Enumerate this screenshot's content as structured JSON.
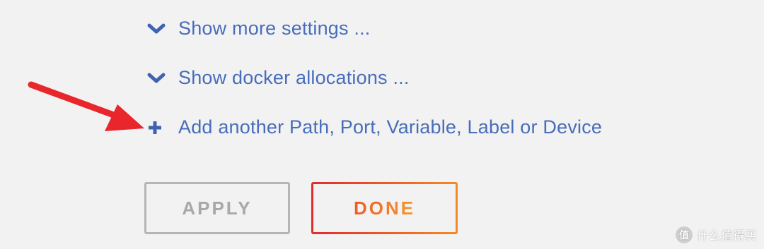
{
  "links": {
    "more_settings": {
      "label": "Show more settings ...",
      "icon": "chevron-down-icon"
    },
    "docker_allocations": {
      "label": "Show docker allocations ...",
      "icon": "chevron-down-icon"
    },
    "add_another": {
      "label": "Add another Path, Port, Variable, Label or Device",
      "icon": "plus-icon"
    }
  },
  "buttons": {
    "apply_label": "APPLY",
    "done_label": "DONE"
  },
  "watermark": {
    "text": "什么值得买",
    "logo_glyph": "值"
  },
  "colors": {
    "link": "#486dba",
    "apply_border": "#b5b5b5",
    "apply_text": "#a8a8a8",
    "done_gradient_start": "#e22b2b",
    "done_gradient_end": "#f48a25",
    "arrow": "#e8262b",
    "background": "#f2f2f2"
  }
}
